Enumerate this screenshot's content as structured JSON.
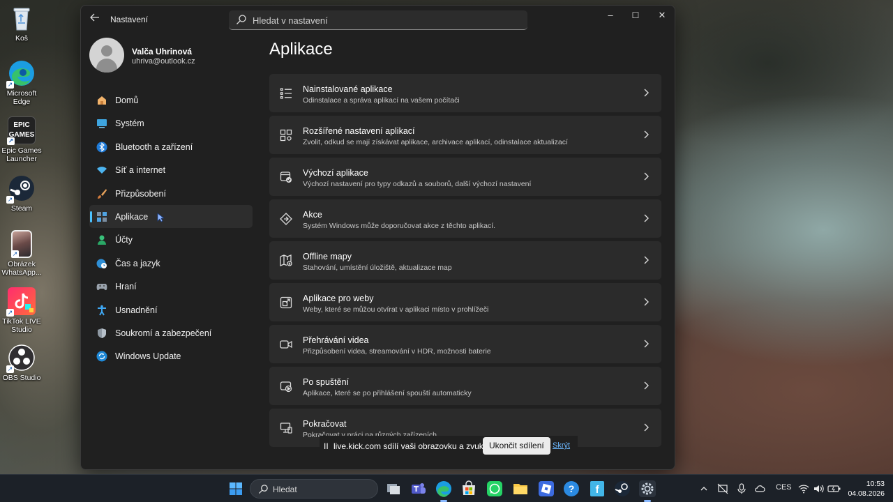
{
  "desktop": {
    "icons": [
      {
        "label": "Koš",
        "icon": "recycle-bin-icon"
      },
      {
        "label": "Microsoft Edge",
        "icon": "edge-icon"
      },
      {
        "label": "Epic Games Launcher",
        "icon": "epic-games-icon",
        "badge": "EPIC GAMES"
      },
      {
        "label": "Steam",
        "icon": "steam-icon"
      },
      {
        "label": "Obrázek WhatsApp...",
        "icon": "image-file-icon"
      },
      {
        "label": "TikTok LIVE Studio",
        "icon": "tiktok-icon"
      },
      {
        "label": "OBS Studio",
        "icon": "obs-icon"
      }
    ]
  },
  "window": {
    "title": "Nastavení",
    "search_placeholder": "Hledat v nastavení",
    "controls": {
      "minimize": "–",
      "maximize": "☐",
      "close": "✕"
    }
  },
  "profile": {
    "name": "Valča Uhrinová",
    "email": "uhriva@outlook.cz"
  },
  "sidebar": {
    "items": [
      {
        "label": "Domů",
        "icon": "home-icon"
      },
      {
        "label": "Systém",
        "icon": "system-icon"
      },
      {
        "label": "Bluetooth a zařízení",
        "icon": "bluetooth-icon"
      },
      {
        "label": "Síť a internet",
        "icon": "wifi-icon"
      },
      {
        "label": "Přizpůsobení",
        "icon": "brush-icon"
      },
      {
        "label": "Aplikace",
        "icon": "apps-icon",
        "active": true
      },
      {
        "label": "Účty",
        "icon": "account-icon"
      },
      {
        "label": "Čas a jazyk",
        "icon": "globe-clock-icon"
      },
      {
        "label": "Hraní",
        "icon": "gamepad-icon"
      },
      {
        "label": "Usnadnění",
        "icon": "accessibility-icon"
      },
      {
        "label": "Soukromí a zabezpečení",
        "icon": "shield-icon"
      },
      {
        "label": "Windows Update",
        "icon": "update-icon"
      }
    ]
  },
  "main": {
    "title": "Aplikace",
    "cards": [
      {
        "title": "Nainstalované aplikace",
        "desc": "Odinstalace a správa aplikací na vašem počítači",
        "icon": "list-icon"
      },
      {
        "title": "Rozšířené nastavení aplikací",
        "desc": "Zvolit, odkud se mají získávat aplikace, archivace aplikací, odinstalace aktualizací",
        "icon": "apps-settings-icon"
      },
      {
        "title": "Výchozí aplikace",
        "desc": "Výchozí nastavení pro typy odkazů a souborů, další výchozí nastavení",
        "icon": "default-apps-icon"
      },
      {
        "title": "Akce",
        "desc": "Systém Windows může doporučovat akce z těchto aplikací.",
        "icon": "actions-icon"
      },
      {
        "title": "Offline mapy",
        "desc": "Stahování, umístění úložiště, aktualizace map",
        "icon": "map-icon"
      },
      {
        "title": "Aplikace pro weby",
        "desc": "Weby, které se můžou otvírat v aplikaci místo v prohlížeči",
        "icon": "open-in-app-icon"
      },
      {
        "title": "Přehrávání videa",
        "desc": "Přizpůsobení videa, streamování v HDR, možnosti baterie",
        "icon": "video-icon"
      },
      {
        "title": "Po spuštění",
        "desc": "Aplikace, které se po přihlášení spouští automaticky",
        "icon": "startup-icon"
      },
      {
        "title": "Pokračovat",
        "desc": "Pokračovat v práci na různých zařízeních",
        "icon": "continue-icon"
      }
    ]
  },
  "share_bar": {
    "pause": "II",
    "text": "live.kick.com sdílí vaši obrazovku a zvuk.",
    "stop_label": "Ukončit sdílení",
    "hide_label": "Skrýt"
  },
  "taskbar": {
    "search_label": "Hledat",
    "apps": [
      "task-view-icon",
      "teams-icon",
      "edge-icon",
      "store-icon",
      "whatsapp-icon",
      "file-explorer-icon",
      "roblox-icon",
      "help-icon",
      "f-app-icon",
      "steam-icon",
      "settings-icon"
    ],
    "tray": {
      "language": "CES",
      "time": "10:53",
      "date": "04.08.2026"
    }
  },
  "colors": {
    "accent": "#4cc2ff",
    "window_bg": "#202020",
    "card_bg": "#2b2b2b",
    "taskbar_bg": "#1c2128"
  }
}
